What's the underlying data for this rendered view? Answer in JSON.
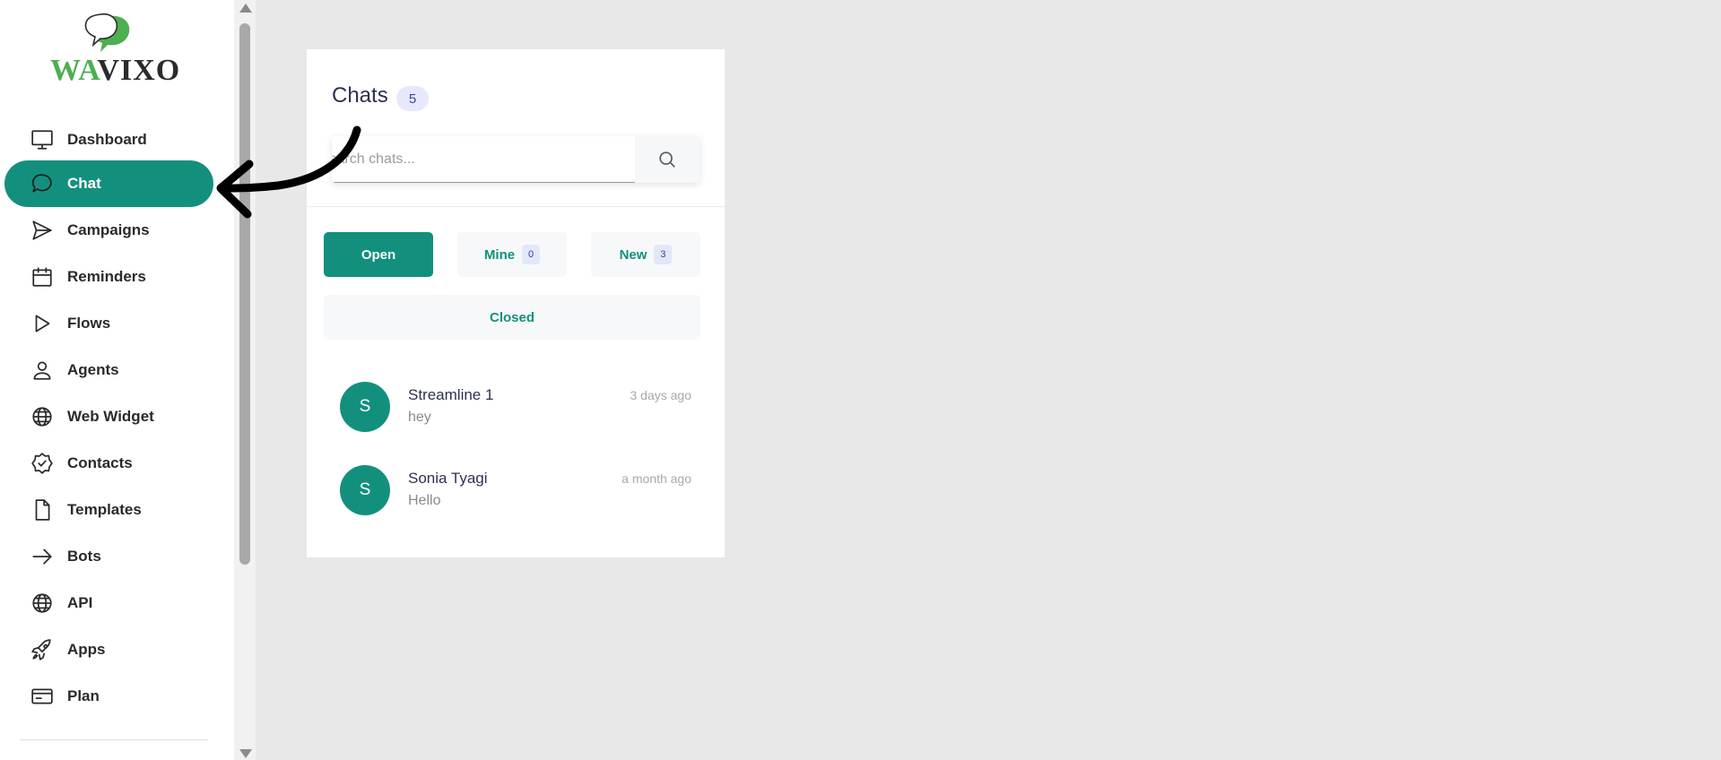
{
  "logo": {
    "part1": "WA",
    "part2": "VIXO",
    "colors": {
      "green": "#4caf50",
      "dark": "#2b2b2b"
    }
  },
  "sidebar": {
    "items": [
      {
        "label": "Dashboard",
        "icon": "monitor-icon"
      },
      {
        "label": "Chat",
        "icon": "chat-bubble-icon",
        "active": true
      },
      {
        "label": "Campaigns",
        "icon": "send-icon"
      },
      {
        "label": "Reminders",
        "icon": "calendar-icon"
      },
      {
        "label": "Flows",
        "icon": "play-icon"
      },
      {
        "label": "Agents",
        "icon": "user-icon"
      },
      {
        "label": "Web Widget",
        "icon": "globe-icon"
      },
      {
        "label": "Contacts",
        "icon": "badge-check-icon"
      },
      {
        "label": "Templates",
        "icon": "file-icon"
      },
      {
        "label": "Bots",
        "icon": "arrow-right-icon"
      },
      {
        "label": "API",
        "icon": "globe-icon"
      },
      {
        "label": "Apps",
        "icon": "rocket-icon"
      },
      {
        "label": "Plan",
        "icon": "credit-card-icon"
      }
    ]
  },
  "chats": {
    "title": "Chats",
    "count": "5",
    "search_placeholder": "Search chats...",
    "filters": {
      "open": "Open",
      "mine": "Mine",
      "mine_count": "0",
      "new": "New",
      "new_count": "3",
      "closed": "Closed"
    },
    "list": [
      {
        "initial": "S",
        "name": "Streamline 1",
        "preview": "hey",
        "time": "3 days ago"
      },
      {
        "initial": "S",
        "name": "Sonia Tyagi",
        "preview": "Hello",
        "time": "a month ago"
      }
    ]
  },
  "colors": {
    "accent": "#13907d",
    "badge_bg": "#e6e9fb",
    "badge_text": "#3a43a0"
  }
}
